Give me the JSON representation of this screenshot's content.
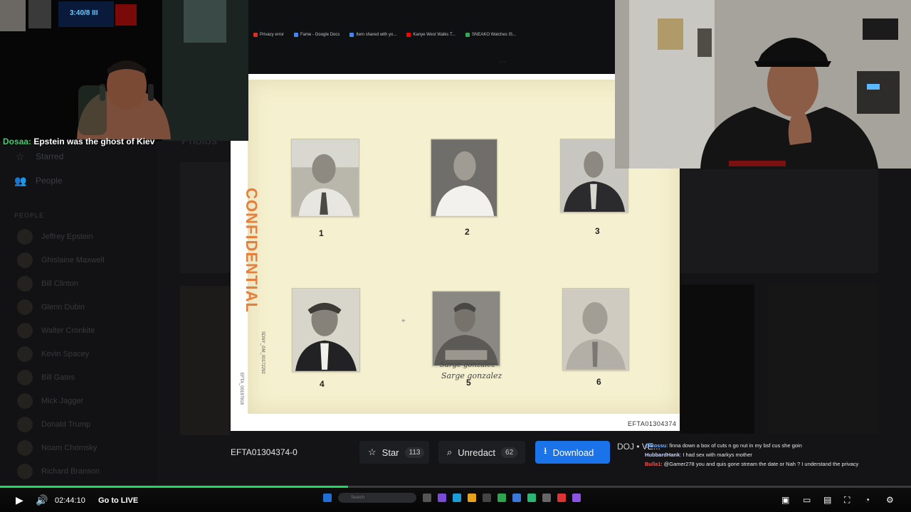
{
  "browser": {
    "bookmarks": [
      {
        "label": "Privacy error",
        "color": "#d93025"
      },
      {
        "label": "Fame - Google Docs",
        "color": "#4285f4"
      },
      {
        "label": "Item shared with yo...",
        "color": "#4285f4"
      },
      {
        "label": "Kanye West Walks T...",
        "color": "#ff0000"
      },
      {
        "label": "SNEAKO Watches IS...",
        "color": "#34a853"
      }
    ]
  },
  "sidebar": {
    "nav": [
      {
        "label": "Starred",
        "icon": "star-icon"
      },
      {
        "label": "People",
        "icon": "people-icon"
      }
    ],
    "section": "PEOPLE",
    "people": [
      "Jeffrey Epstein",
      "Ghislaine Maxwell",
      "Bill Clinton",
      "Glenn Dubin",
      "Walter Cronkite",
      "Kevin Spacey",
      "Bill Gates",
      "Mick Jagger",
      "Donald Trump",
      "Noam Chomsky",
      "Richard Branson"
    ]
  },
  "background": {
    "title": "Photos"
  },
  "document": {
    "stamp": "CONFIDENTIAL",
    "side_code_1": "SDNY_GM_00172292",
    "side_code_2": "EFTA_00197918",
    "bates": "EFTA01304374",
    "photos": [
      {
        "number": "1"
      },
      {
        "number": "2"
      },
      {
        "number": "3"
      },
      {
        "number": "4"
      },
      {
        "number": "5",
        "signature_1": "Sarge gonzalez",
        "signature_2": "Sarge gonzalez"
      },
      {
        "number": "6"
      }
    ]
  },
  "toolbar": {
    "doc_id": "EFTA01304374-0",
    "star_label": "Star",
    "star_count": "113",
    "unredact_label": "Unredact",
    "unredact_count": "62",
    "download_label": "Download",
    "doj_label": "DOJ • VE..."
  },
  "chat": [
    {
      "user": "@Bossu",
      "user_color": "#7fb3ff",
      "text": ": finna down a box of cuts n go nut in my bsf cus she goin"
    },
    {
      "user": "HubbardHank",
      "user_color": "#c9d6ff",
      "text": ": I had sex with markys mother"
    },
    {
      "user": "Bulla1",
      "user_color": "#ff4d4d",
      "text": ": @Gamer278 you and quis gone stream the date or Nah ? I understand the privacy"
    }
  ],
  "stream_overlay": {
    "user": "Dosaa:",
    "message": " Epstein was the ghost of Kiev",
    "hud_text": "3:40/8 III"
  },
  "player": {
    "timecode": "02:44:10",
    "live_label": "Go to LIVE",
    "progress": 0.382,
    "buffered": 0.382,
    "accent": "#1ed760"
  }
}
